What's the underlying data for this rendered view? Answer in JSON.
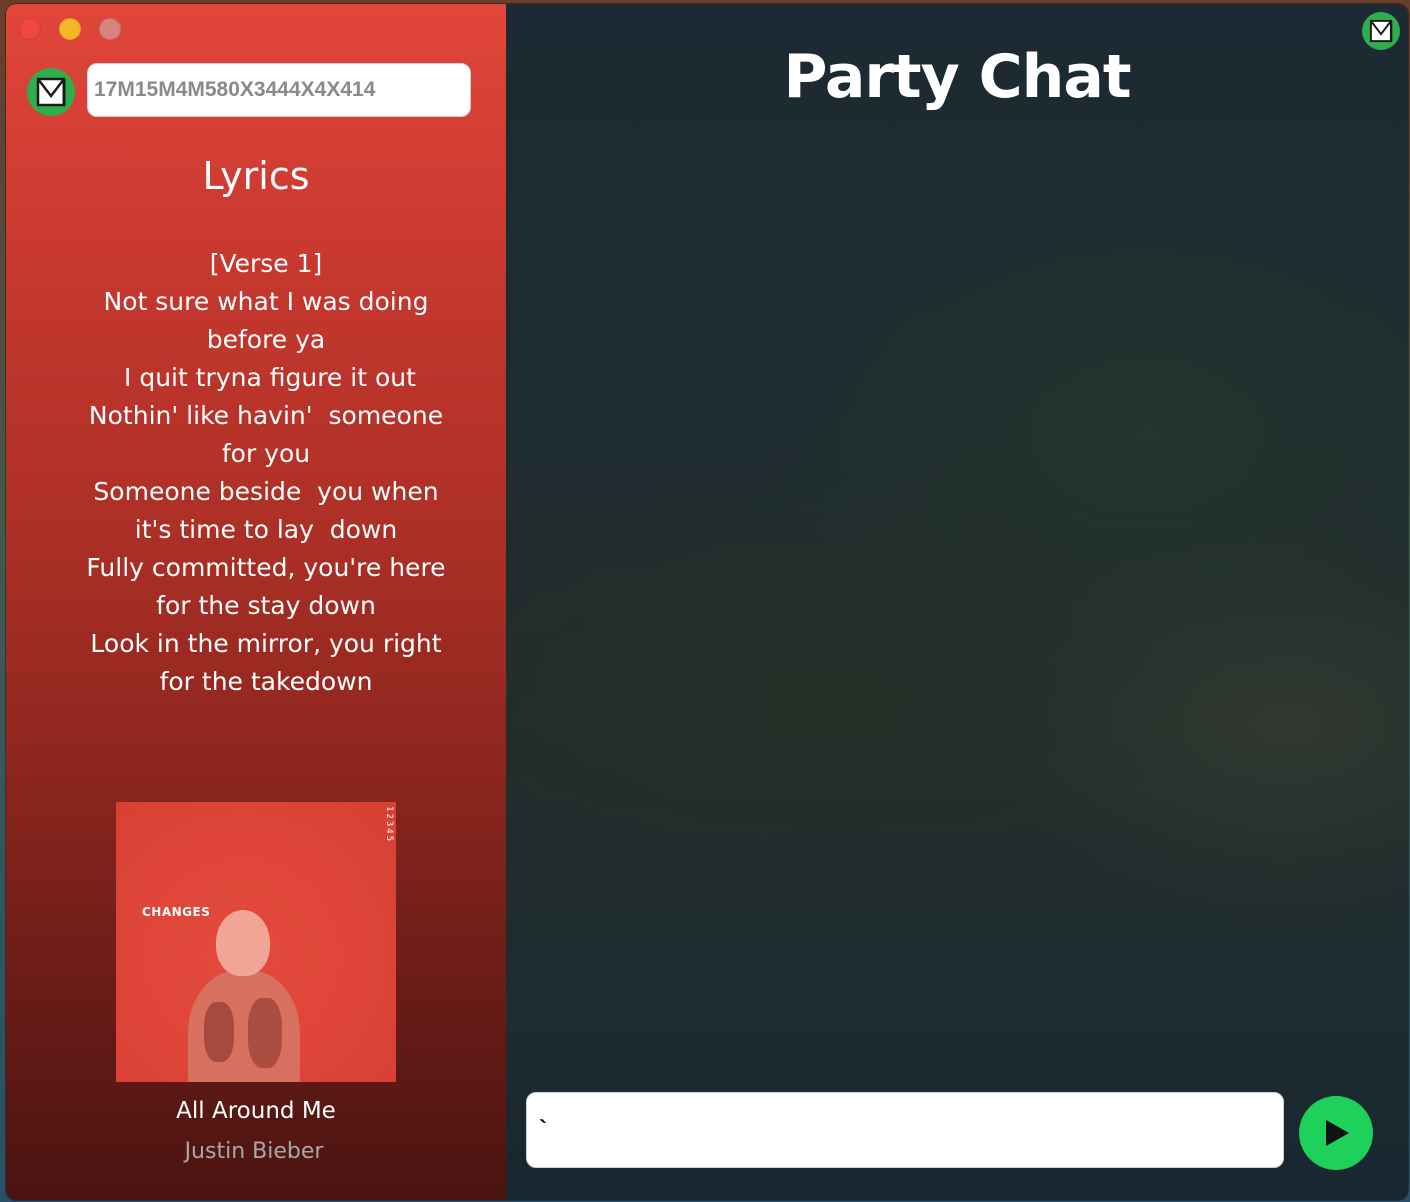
{
  "window": {
    "controls": [
      "close",
      "minimize",
      "maximize"
    ]
  },
  "sidebar": {
    "logo_icon": "app-logo-icon",
    "room_code_value": "17M15M4M580X3444X4X414",
    "lyrics_heading": "Lyrics",
    "lyrics_lines": [
      "[Verse 1]",
      "Not sure what I was doing",
      "before ya",
      " I quit tryna figure it out",
      "Nothin' like havin'  someone",
      "for you",
      "Someone beside  you when",
      "it's time to lay  down",
      "Fully committed, you're here",
      "for the stay down",
      "Look in the mirror, you right",
      "for the takedown"
    ],
    "album": {
      "cover_text": "CHANGES",
      "side_text": "12345"
    },
    "track_title": "All Around Me",
    "track_artist": "Justin Bieber"
  },
  "chat": {
    "title": "Party Chat",
    "logo_icon": "app-logo-icon",
    "input_value": "`",
    "send_icon": "play-send-icon"
  },
  "colors": {
    "left_panel_top": "#e2463a",
    "left_panel_bottom": "#4a1411",
    "chat_bg": "#1f2c30",
    "accent_green": "#1ed15a",
    "logo_green": "#2fae4f",
    "artist_gray": "#a8a8a8"
  }
}
